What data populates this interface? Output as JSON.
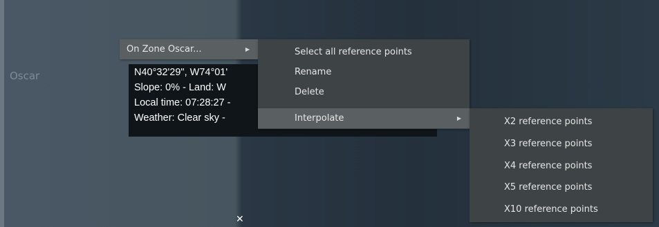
{
  "map": {
    "zone_label": "Oscar"
  },
  "info_panel": {
    "coordinates": "N40°32'29\", W74°01'",
    "slope_land": "Slope: 0%  - Land: W",
    "local_time": "Local time: 07:28:27 -",
    "weather": "Weather: Clear sky -"
  },
  "context_menu": {
    "zone_item": "On Zone Oscar...",
    "actions": [
      {
        "label": "Select all reference points"
      },
      {
        "label": "Rename"
      },
      {
        "label": "Delete"
      },
      {
        "label": "Interpolate"
      }
    ],
    "interpolate_submenu": [
      {
        "label": "X2 reference points"
      },
      {
        "label": "X3 reference points"
      },
      {
        "label": "X4 reference points"
      },
      {
        "label": "X5 reference points"
      },
      {
        "label": "X10 reference points"
      }
    ]
  },
  "icons": {
    "submenu_arrow": "▶",
    "close": "✕"
  },
  "colors": {
    "menu_bg": "#3e4346",
    "menu_highlight": "#5a5f62",
    "panel_bg": "#0f1518",
    "menu_text": "#e6e6e6"
  }
}
